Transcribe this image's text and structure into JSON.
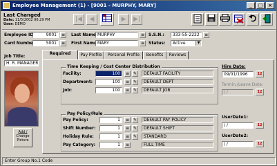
{
  "window": {
    "title": "Employee Management (1) - [9001 - MURPHY, MARY]",
    "minimize_glyph": "_",
    "maximize_glyph": "□",
    "close_glyph": "×"
  },
  "last_changed": {
    "heading": "Last Changed",
    "date_label": "Date:",
    "date_value": "11/5/2002 06:29 PM",
    "user_label": "User:",
    "user_value": "DEMO"
  },
  "nav": {
    "first_glyph": "|◀",
    "prev_glyph": "◀",
    "next_glyph": "▶",
    "last_glyph": "▶|"
  },
  "fields": {
    "employee_id_label": "Employee ID:",
    "employee_id_value": "9001",
    "card_number_label": "Card Number:",
    "card_number_value": "5001",
    "last_name_label": "Last Name:",
    "last_name_value": "MURPHY",
    "first_name_label": "First Name:",
    "first_name_value": "MARY",
    "ssn_label": "S.S.N.:",
    "ssn_value": "333-55-2222",
    "status_label": "Status:",
    "status_value": "Active",
    "job_title_label": "Job Title:",
    "job_title_value": "H. R. MANAGER"
  },
  "photo_button": {
    "line1": "Add /",
    "line2": "Change",
    "line3": "Picture"
  },
  "tabs": [
    "Required",
    "Pay Profile",
    "Personal Profile",
    "Benefits",
    "Reviews"
  ],
  "timekeeping": {
    "title": "Time Keeping / Cost Center Distribution",
    "rows": [
      {
        "label": "Facility:",
        "value": "100",
        "desc": "DEFAULT FACILITY"
      },
      {
        "label": "Department:",
        "value": "100",
        "desc": "DEFAULT DEPT"
      },
      {
        "label": "Job:",
        "value": "100",
        "desc": "DEFAULT JOB"
      }
    ]
  },
  "paypolicy": {
    "title": "Pay Policy/Rule",
    "rows": [
      {
        "label": "Pay Policy:",
        "value": "1",
        "desc": "DEFAULT PAY POLICY"
      },
      {
        "label": "Shift Number:",
        "value": "1",
        "desc": "DEFAULT SHIFT"
      },
      {
        "label": "Holiday Rule:",
        "value": "1",
        "desc": "STANDARD"
      },
      {
        "label": "Pay Category:",
        "value": "1",
        "desc": "FULL TIME"
      }
    ]
  },
  "dates": {
    "hire_label": "Hire Date:",
    "hire_value": "09/01/1996",
    "term_label": "Termin./Leave Date:",
    "term_value": "/ /",
    "user1_label": "UserDate1:",
    "user1_value": "/ /",
    "user2_label": "UserDate2:",
    "user2_value": "/ /",
    "cal_glyph": "12"
  },
  "status_bar": {
    "text": "Enter Group No.1 Code"
  },
  "colors": {
    "title_bar": "#0a246a",
    "selected_field": "#0a246a",
    "window_bg": "#d4d0c8"
  }
}
